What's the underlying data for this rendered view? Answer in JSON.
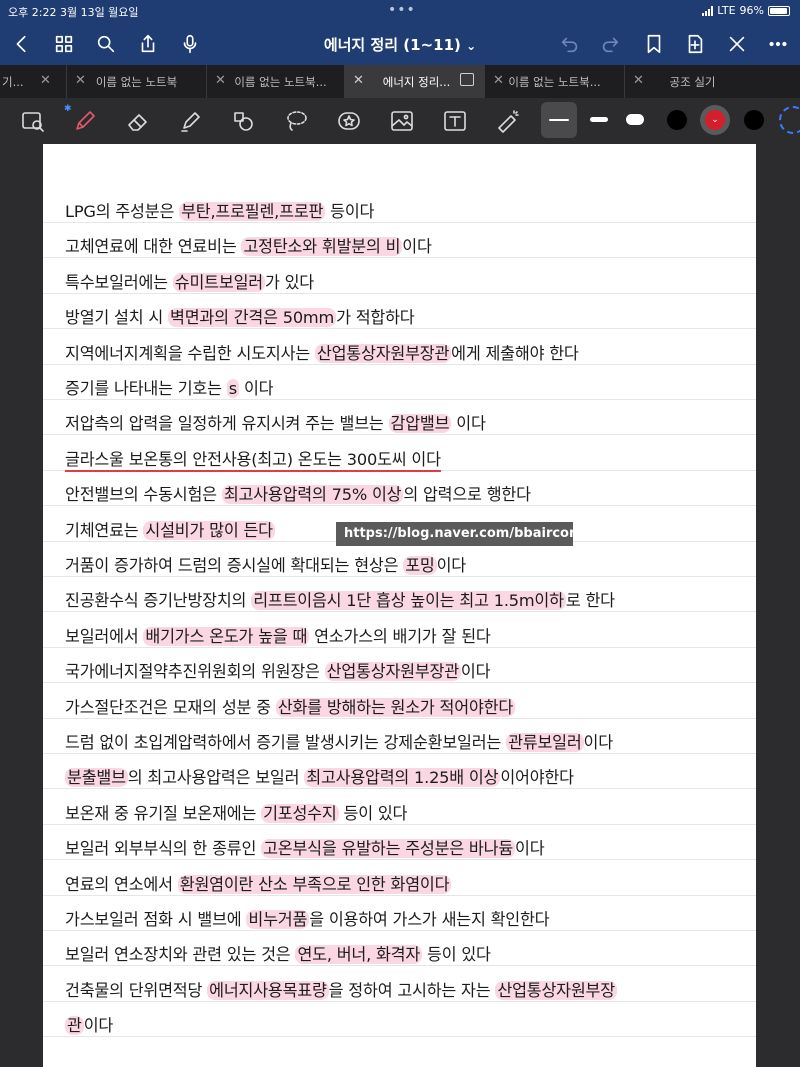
{
  "status_bar": {
    "time": "오후 2:22",
    "date": "3월 13일 월요일",
    "network": "LTE",
    "battery": "96%",
    "battery_level": 0.96
  },
  "nav": {
    "title": "에너지 정리 (1~11)",
    "title_chevron": "⌄"
  },
  "tabs": [
    {
      "label": "기..."
    },
    {
      "label": "이름 없는 노트북"
    },
    {
      "label": "이름 없는 노트북..."
    },
    {
      "label": "에너지 정리..."
    },
    {
      "label": "이름 없는 노트북..."
    },
    {
      "label": "공조 실기"
    }
  ],
  "toolbar": {
    "selected_stroke": "thin",
    "colors": [
      "#000000",
      "#d21f2b",
      "#000000"
    ],
    "selected_color": "#d21f2b",
    "accent": "#1f3c73"
  },
  "watermark": "https://blog.naver.com/bbaircon",
  "notes": [
    [
      {
        "t": "LPG의 주성분은 "
      },
      {
        "t": "부탄,프로필렌,프로판",
        "h": 1
      },
      {
        "t": " 등이다"
      }
    ],
    [
      {
        "t": "고체연료에 대한 연료비는 "
      },
      {
        "t": "고정탄소와 휘발분의 비",
        "h": 1
      },
      {
        "t": "이다"
      }
    ],
    [
      {
        "t": "특수보일러에는 "
      },
      {
        "t": "슈미트보일러",
        "h": 1
      },
      {
        "t": "가 있다"
      }
    ],
    [
      {
        "t": "방열기 설치 시 "
      },
      {
        "t": "벽면과의 간격은 50mm",
        "h": 1
      },
      {
        "t": "가 적합하다"
      }
    ],
    [
      {
        "t": "지역에너지계획을 수립한 시도지사는 "
      },
      {
        "t": "산업통상자원부장관",
        "h": 1
      },
      {
        "t": "에게 제출해야 한다"
      }
    ],
    [
      {
        "t": "증기를 나타내는 기호는 "
      },
      {
        "t": "s",
        "h": 1
      },
      {
        "t": " 이다"
      }
    ],
    [
      {
        "t": "저압측의 압력을 일정하게 유지시켜 주는 밸브는 "
      },
      {
        "t": "감압밸브",
        "h": 1
      },
      {
        "t": " 이다"
      }
    ],
    [
      {
        "t": "글라스울 보온통의 안전사용(최고) 온도는 300도씨 이다",
        "u": 1
      }
    ],
    [
      {
        "t": "안전밸브의 수동시험은 "
      },
      {
        "t": "최고사용압력의 75% 이상",
        "h": 1
      },
      {
        "t": "의 압력으로 행한다"
      }
    ],
    [
      {
        "t": "기체연료는 "
      },
      {
        "t": "시설비가 많이 든다",
        "h": 1
      }
    ],
    [
      {
        "t": "거품이 증가하여 드럼의 증시실에 확대되는 현상은 "
      },
      {
        "t": "포밍",
        "h": 1
      },
      {
        "t": "이다"
      }
    ],
    [
      {
        "t": "진공환수식 증기난방장치의 "
      },
      {
        "t": "리프트이음시 1단 흡상 높이는 최고 1.5m이하",
        "h": 1
      },
      {
        "t": "로 한다"
      }
    ],
    [
      {
        "t": "보일러에서 "
      },
      {
        "t": "배기가스 온도가 높을 때",
        "h": 1
      },
      {
        "t": " 연소가스의 배기가 잘 된다"
      }
    ],
    [
      {
        "t": "국가에너지절약추진위원회의 위원장은 "
      },
      {
        "t": "산업통상자원부장관",
        "h": 1
      },
      {
        "t": "이다"
      }
    ],
    [
      {
        "t": "가스절단조건은 모재의 성분 중 "
      },
      {
        "t": "산화를 방해하는 원소가 적어야한다",
        "h": 1
      }
    ],
    [
      {
        "t": "드럼 없이 초입계압력하에서 증기를 발생시키는 강제순환보일러는 "
      },
      {
        "t": "관류보일러",
        "h": 1
      },
      {
        "t": "이다"
      }
    ],
    [
      {
        "t": "분출밸브",
        "h": 1
      },
      {
        "t": "의 최고사용압력은 보일러 "
      },
      {
        "t": "최고사용압력의 1.25배 이상",
        "h": 1
      },
      {
        "t": "이어야한다"
      }
    ],
    [
      {
        "t": "보온재 중 유기질 보온재에는 "
      },
      {
        "t": "기포성수지",
        "h": 1
      },
      {
        "t": " 등이 있다"
      }
    ],
    [
      {
        "t": "보일러 외부부식의 한 종류인 "
      },
      {
        "t": "고온부식을 유발하는 주성분은 바나듐",
        "h": 1
      },
      {
        "t": "이다"
      }
    ],
    [
      {
        "t": "연료의 연소에서 "
      },
      {
        "t": "환원염이란 산소 부족으로 인한 화염이다",
        "h": 1
      }
    ],
    [
      {
        "t": "가스보일러 점화 시 밸브에 "
      },
      {
        "t": "비누거품",
        "h": 1
      },
      {
        "t": "을 이용하여 가스가 새는지 확인한다"
      }
    ],
    [
      {
        "t": "보일러 연소장치와 관련 있는 것은 "
      },
      {
        "t": "연도, 버너, 화격자",
        "h": 1
      },
      {
        "t": " 등이 있다"
      }
    ],
    [
      {
        "t": "건축물의 단위면적당 "
      },
      {
        "t": "에너지사용목표량",
        "h": 1
      },
      {
        "t": "을 정하여 고시하는 자는 "
      },
      {
        "t": "산업통상자원부장",
        "h": 1
      }
    ],
    [
      {
        "t": "관",
        "h": 1
      },
      {
        "t": "이다"
      }
    ]
  ]
}
